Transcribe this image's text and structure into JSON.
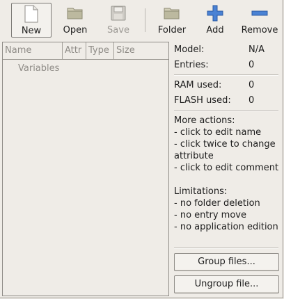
{
  "toolbar": {
    "new": "New",
    "open": "Open",
    "save": "Save",
    "folder": "Folder",
    "add": "Add",
    "remove": "Remove"
  },
  "list": {
    "columns": [
      "Name",
      "Attr",
      "Type",
      "Size"
    ],
    "root_item": "Variables"
  },
  "info": {
    "model_label": "Model:",
    "model_value": "N/A",
    "entries_label": "Entries:",
    "entries_value": "0",
    "ram_label": "RAM used:",
    "ram_value": "0",
    "flash_label": "FLASH used:",
    "flash_value": "0",
    "more_actions": "More actions:\n- click to edit name\n- click twice to change\nattribute\n- click to edit comment",
    "limitations": "Limitations:\n- no folder deletion\n- no entry move\n- no application edition"
  },
  "buttons": {
    "group": "Group files...",
    "ungroup": "Ungroup file..."
  },
  "colors": {
    "add_icon": "#3a73c8",
    "remove_icon": "#3a73c8",
    "folder_icon": "#b9b59b"
  }
}
